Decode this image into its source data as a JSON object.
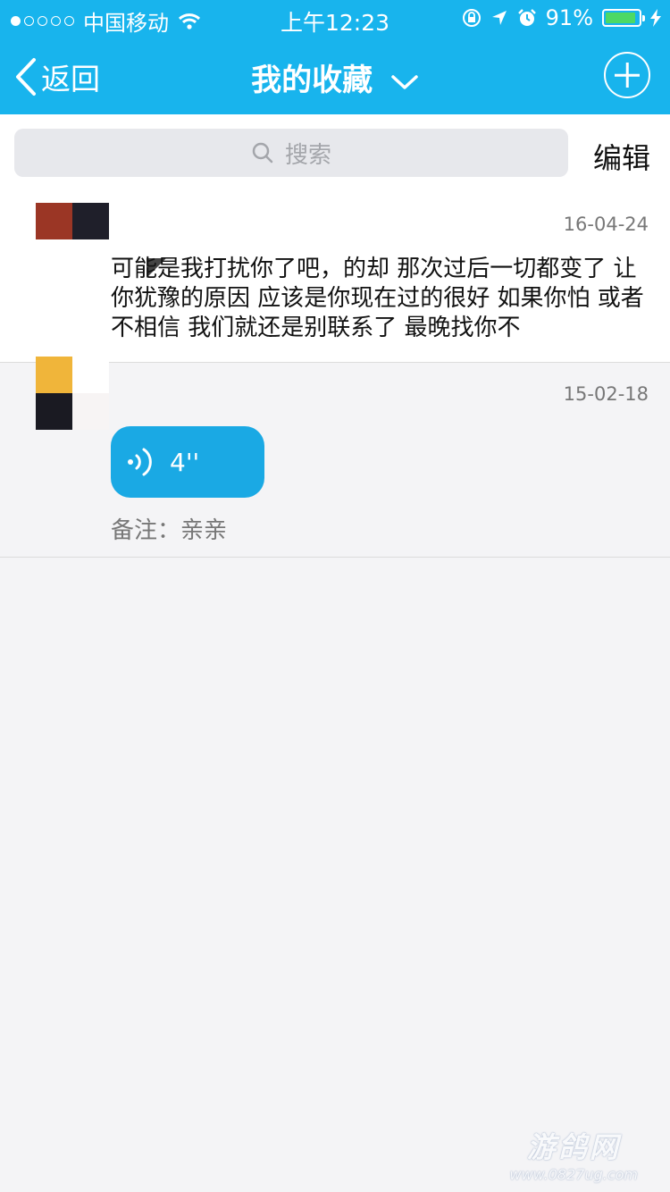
{
  "status_bar": {
    "carrier": "中国移动",
    "time": "上午12:23",
    "battery": "91%",
    "battery_level": 0.91
  },
  "nav": {
    "back_label": "返回",
    "title": "我的收藏"
  },
  "search": {
    "placeholder": "搜索",
    "edit_label": "编辑"
  },
  "items": [
    {
      "date": "16-04-24",
      "text": "可能是我打扰你了吧，的却 那次过后一切都变了 让你犹豫的原因 应该是你现在过的很好  如果你怕 或者不相信 我们就还是别联系了 最晚找你不"
    },
    {
      "date": "15-02-18",
      "voice_duration": "4''",
      "note": "备注：亲亲"
    }
  ],
  "watermark": {
    "title": "游鸽网",
    "url": "www.0827ug.com"
  },
  "colors": {
    "nav_bg": "#18b4ed",
    "voice_bubble": "#1aa9e4",
    "battery_fill": "#4cd964"
  }
}
